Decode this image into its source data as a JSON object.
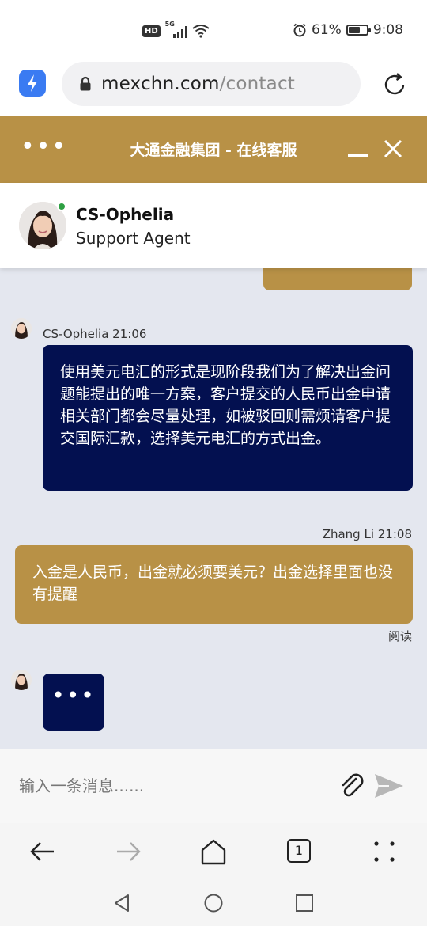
{
  "status_bar": {
    "network_badge": "HD",
    "network_type": "5G",
    "battery_percent": "61%",
    "battery_level": 0.61,
    "time": "9:08"
  },
  "browser": {
    "url_domain": "mexchn.com",
    "url_path": "/contact"
  },
  "chat_header": {
    "menu_label": "•••",
    "title": "大通金融集团 - 在线客服"
  },
  "agent": {
    "name": "CS-Ophelia",
    "role": "Support Agent",
    "status_color": "#2ea043"
  },
  "messages": [
    {
      "sender": "CS-Ophelia",
      "meta": "CS-Ophelia 21:06",
      "text": "使用美元电汇的形式是现阶段我们为了解决出金问题能提出的唯一方案，客户提交的人民币出金申请相关部门都会尽量处理，如被驳回则需烦请客户提交国际汇款，选择美元电汇的方式出金。"
    },
    {
      "sender": "Zhang Li",
      "meta": "Zhang Li 21:08",
      "text": "入金是人民币，出金就必须要美元？出金选择里面也没有提醒",
      "read_status": "阅读"
    }
  ],
  "typing_indicator": "•••",
  "composer": {
    "placeholder": "输入一条消息......",
    "attach_icon": "paperclip-icon",
    "send_icon": "send-icon"
  },
  "browser_nav": {
    "tab_count": "1"
  },
  "colors": {
    "brand_gold": "#b89146",
    "agent_bubble": "#031050",
    "chat_background": "#e4e7ef"
  }
}
